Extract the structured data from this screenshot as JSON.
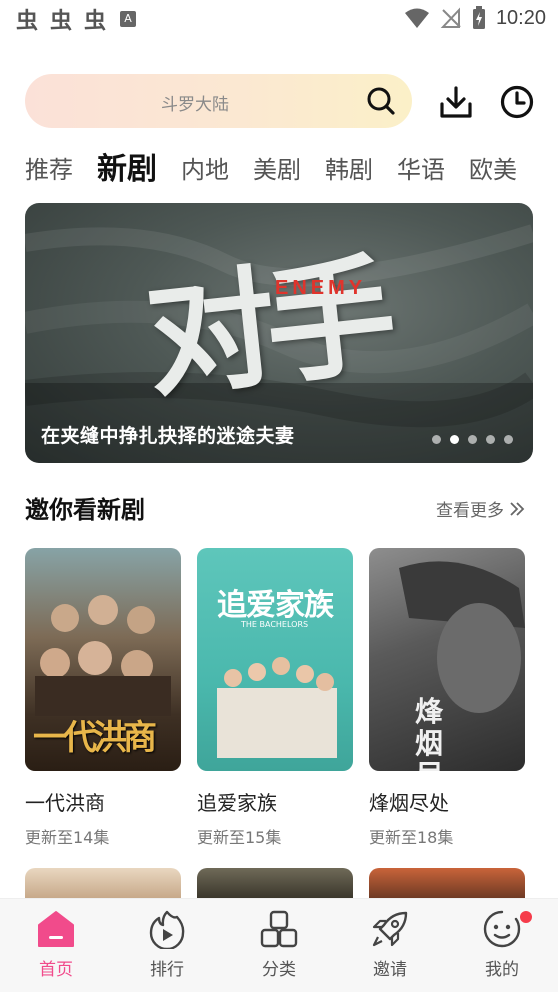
{
  "status": {
    "time": "10:20",
    "notif_glyph": "虫",
    "a_icon": "A"
  },
  "search": {
    "placeholder": "斗罗大陆"
  },
  "tabs": [
    {
      "label": "推荐",
      "active": false
    },
    {
      "label": "新剧",
      "active": true
    },
    {
      "label": "内地",
      "active": false
    },
    {
      "label": "美剧",
      "active": false
    },
    {
      "label": "韩剧",
      "active": false
    },
    {
      "label": "华语",
      "active": false
    },
    {
      "label": "欧美",
      "active": false
    }
  ],
  "banner": {
    "title": "在夹缝中挣扎抉择的迷途夫妻",
    "poster_word": "对手",
    "poster_en": "ENEMY",
    "dots": 5,
    "active_dot": 1
  },
  "section": {
    "title": "邀你看新剧",
    "see_more": "查看更多"
  },
  "cards": [
    {
      "title": "一代洪商",
      "subtitle": "更新至14集",
      "poster_text": "一代洪商"
    },
    {
      "title": "追爱家族",
      "subtitle": "更新至15集",
      "poster_text": "追爱家族",
      "poster_en": "THE BACHELORS"
    },
    {
      "title": "烽烟尽处",
      "subtitle": "更新至18集",
      "poster_text": "烽烟尽处"
    }
  ],
  "nav": [
    {
      "label": "首页",
      "icon": "home-icon",
      "active": true
    },
    {
      "label": "排行",
      "icon": "ranking-icon",
      "active": false
    },
    {
      "label": "分类",
      "icon": "category-icon",
      "active": false
    },
    {
      "label": "邀请",
      "icon": "invite-rocket-icon",
      "active": false
    },
    {
      "label": "我的",
      "icon": "profile-icon",
      "active": false
    }
  ],
  "colors": {
    "accent": "#f14b8b",
    "badge": "#f53b4a"
  }
}
